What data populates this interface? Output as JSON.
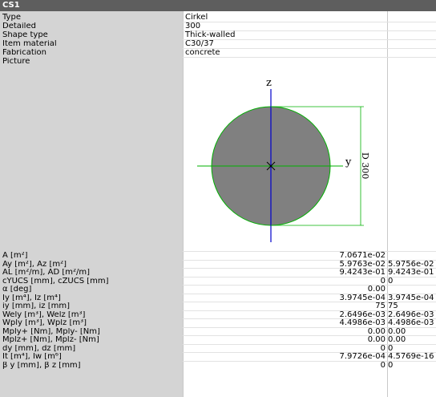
{
  "header": {
    "title": "CS1"
  },
  "props": [
    {
      "label": "Type",
      "value": "Cirkel"
    },
    {
      "label": "Detailed",
      "value": "300"
    },
    {
      "label": "Shape type",
      "value": "Thick-walled"
    },
    {
      "label": "Item material",
      "value": "C30/37"
    },
    {
      "label": "Fabrication",
      "value": "concrete"
    },
    {
      "label": "Picture",
      "value": ""
    }
  ],
  "figure": {
    "z_label": "z",
    "y_label": "y",
    "dim_label": "D 300",
    "colors": {
      "fill": "#808080",
      "outline": "#00b000",
      "y_axis": "#00b000",
      "z_axis": "#0000cc",
      "dim": "#00b000"
    }
  },
  "results": [
    {
      "label": "A [m²]",
      "v1": "7.0671e-02",
      "v2": ""
    },
    {
      "label": "Ay [m²], Az [m²]",
      "v1": "5.9763e-02",
      "v2": "5.9756e-02"
    },
    {
      "label": "AL [m²/m], AD [m²/m]",
      "v1": "9.4243e-01",
      "v2": "9.4243e-01"
    },
    {
      "label": "cYUCS [mm], cZUCS [mm]",
      "v1": "0",
      "v2": "0"
    },
    {
      "label": "α [deg]",
      "v1": "0.00",
      "v2": ""
    },
    {
      "label": "Iy [m⁴], Iz [m⁴]",
      "v1": "3.9745e-04",
      "v2": "3.9745e-04"
    },
    {
      "label": "iy [mm], iz [mm]",
      "v1": "75",
      "v2": "75"
    },
    {
      "label": "Wely [m³], Welz [m³]",
      "v1": "2.6496e-03",
      "v2": "2.6496e-03"
    },
    {
      "label": "Wply [m³], Wplz [m³]",
      "v1": "4.4986e-03",
      "v2": "4.4986e-03"
    },
    {
      "label": "Mply+ [Nm], Mply- [Nm]",
      "v1": "0.00",
      "v2": "0.00"
    },
    {
      "label": "Mplz+ [Nm], Mplz- [Nm]",
      "v1": "0.00",
      "v2": "0.00"
    },
    {
      "label": "dy [mm], dz [mm]",
      "v1": "0",
      "v2": "0"
    },
    {
      "label": "It [m⁴], Iw [m⁶]",
      "v1": "7.9726e-04",
      "v2": "4.5769e-16"
    },
    {
      "label": "β y [mm], β z [mm]",
      "v1": "0",
      "v2": "0"
    }
  ]
}
